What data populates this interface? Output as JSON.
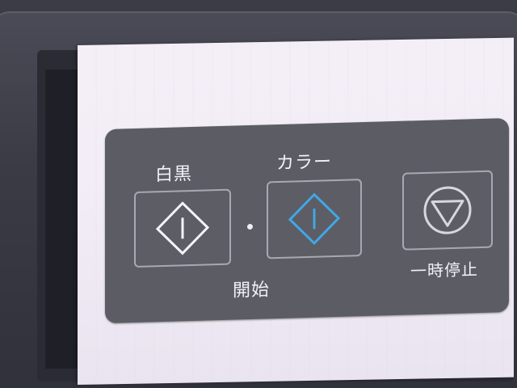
{
  "panel": {
    "mono_label": "白黒",
    "color_label": "カラー",
    "start_label": "開始",
    "pause_label": "一時停止"
  },
  "icons": {
    "mono_start": "start-diamond-icon",
    "color_start": "start-diamond-icon",
    "pause": "stop-triangle-icon"
  },
  "colors": {
    "panel_bg": "#5c5c64",
    "color_accent": "#3fa9e6",
    "label_text": "#f3f1f7"
  }
}
